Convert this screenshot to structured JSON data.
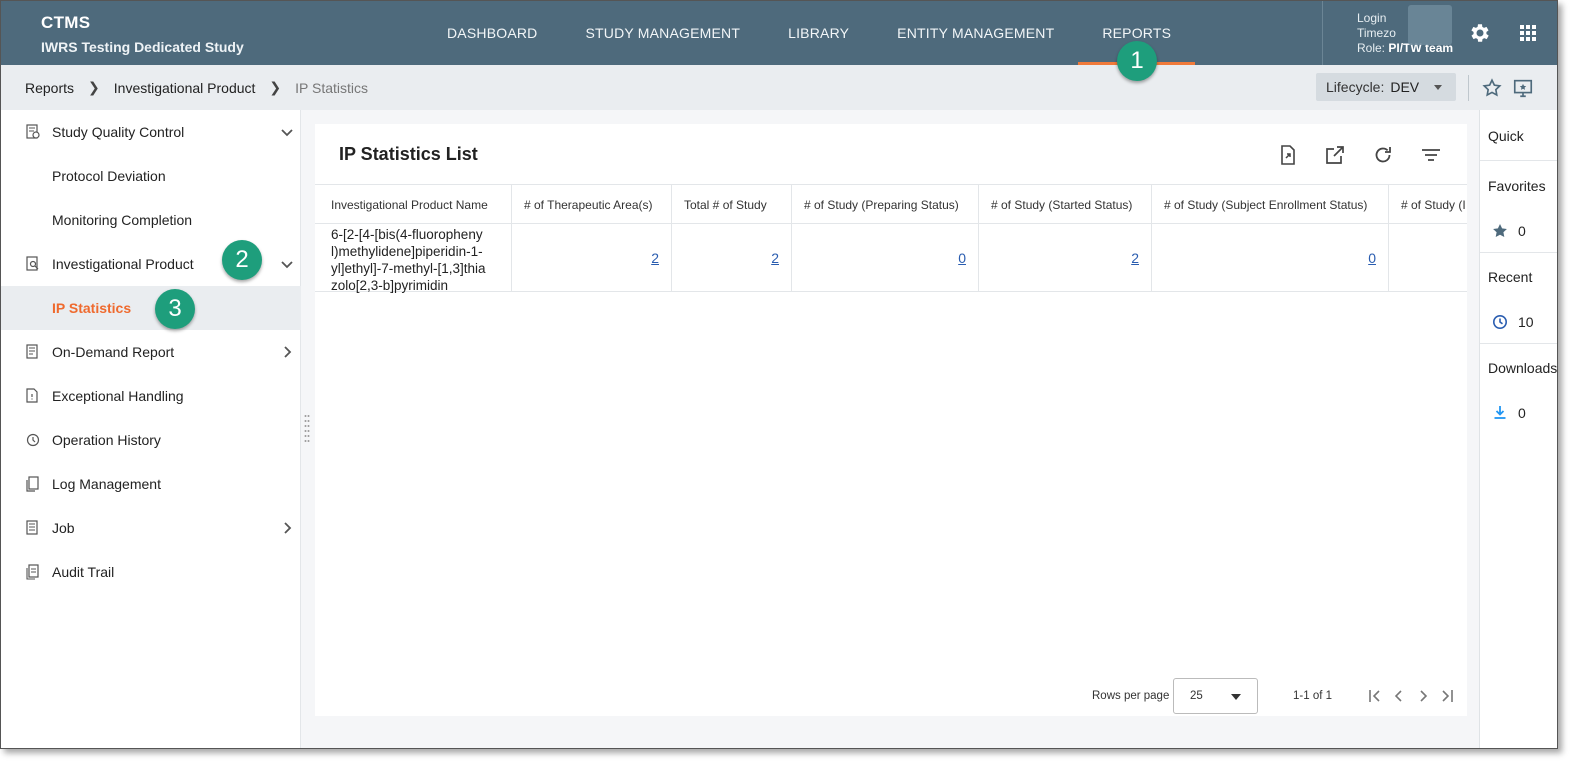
{
  "header": {
    "app_name": "CTMS",
    "study_name": "IWRS Testing Dedicated Study",
    "nav": [
      {
        "label": "DASHBOARD"
      },
      {
        "label": "STUDY MANAGEMENT"
      },
      {
        "label": "LIBRARY"
      },
      {
        "label": "ENTITY MANAGEMENT"
      },
      {
        "label": "REPORTS",
        "active": true
      }
    ],
    "user": {
      "login_label": "Login",
      "timezone_label": "Timezo",
      "role_label": "Role:",
      "role_value": "PI/TW team"
    },
    "icons": [
      "gear-icon",
      "apps-grid-icon"
    ]
  },
  "breadcrumb": {
    "items": [
      "Reports",
      "Investigational Product",
      "IP Statistics"
    ]
  },
  "lifecycle": {
    "label": "Lifecycle:",
    "value": "DEV"
  },
  "sidebar": {
    "items": [
      {
        "label": "Study Quality Control",
        "icon": "document-check-icon",
        "chevron": "down"
      },
      {
        "label": "Protocol Deviation",
        "sub": true
      },
      {
        "label": "Monitoring Completion",
        "sub": true
      },
      {
        "label": "Investigational Product",
        "icon": "document-search-icon",
        "chevron": "down"
      },
      {
        "label": "IP Statistics",
        "sub": true,
        "active": true
      },
      {
        "label": "On-Demand Report",
        "icon": "report-icon",
        "chevron": "right"
      },
      {
        "label": "Exceptional Handling",
        "icon": "document-alert-icon"
      },
      {
        "label": "Operation History",
        "icon": "history-icon"
      },
      {
        "label": "Log Management",
        "icon": "log-icon"
      },
      {
        "label": "Job",
        "icon": "job-icon",
        "chevron": "right"
      },
      {
        "label": "Audit Trail",
        "icon": "audit-icon"
      }
    ]
  },
  "annotations": [
    "1",
    "2",
    "3"
  ],
  "list": {
    "title": "IP Statistics List",
    "columns": [
      "Investigational Product Name",
      "# of Therapeutic Area(s)",
      "Total # of Study",
      "# of Study (Preparing Status)",
      "# of Study (Started Status)",
      "# of Study (Subject Enrollment Status)",
      "# of Study (I"
    ],
    "rows": [
      {
        "name_lines": [
          "6-[2-[4-[bis(4-fluoropheny",
          "l)methylidene]piperidin-1-",
          "yl]ethyl]-7-methyl-[1,3]thia",
          "zolo[2,3-b]pyrimidin"
        ],
        "therapeutic_areas": "2",
        "total_study": "2",
        "preparing": "0",
        "started": "2",
        "subject_enrollment": "0"
      }
    ]
  },
  "pagination": {
    "rows_per_page_label": "Rows per page",
    "rows_per_page": "25",
    "range": "1-1 of 1"
  },
  "quick_panel": {
    "title": "Quick",
    "favorites_label": "Favorites",
    "favorites_count": "0",
    "recent_label": "Recent",
    "recent_count": "10",
    "downloads_label": "Downloads",
    "downloads_count": "0"
  },
  "colors": {
    "header_bg": "#4e6a7c",
    "accent": "#ef6a2e",
    "badge": "#1e9e7c",
    "link": "#2a5db0",
    "download": "#2196f3"
  }
}
